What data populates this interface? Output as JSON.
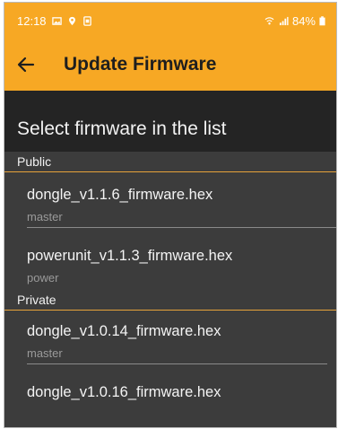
{
  "statusbar": {
    "time": "12:18",
    "battery_text": "84%"
  },
  "appbar": {
    "title": "Update Firmware"
  },
  "header": {
    "title": "Select firmware in the list"
  },
  "sections": [
    {
      "label": "Public",
      "items": [
        {
          "name": "dongle_v1.1.6_firmware.hex",
          "branch": "master"
        },
        {
          "name": "powerunit_v1.1.3_firmware.hex",
          "branch": "power"
        }
      ]
    },
    {
      "label": "Private",
      "items": [
        {
          "name": "dongle_v1.0.14_firmware.hex",
          "branch": "master"
        },
        {
          "name": "dongle_v1.0.16_firmware.hex",
          "branch": ""
        }
      ]
    }
  ],
  "colors": {
    "accent": "#f7a824",
    "header_bg": "#242424",
    "list_bg": "#3c3c3c"
  }
}
